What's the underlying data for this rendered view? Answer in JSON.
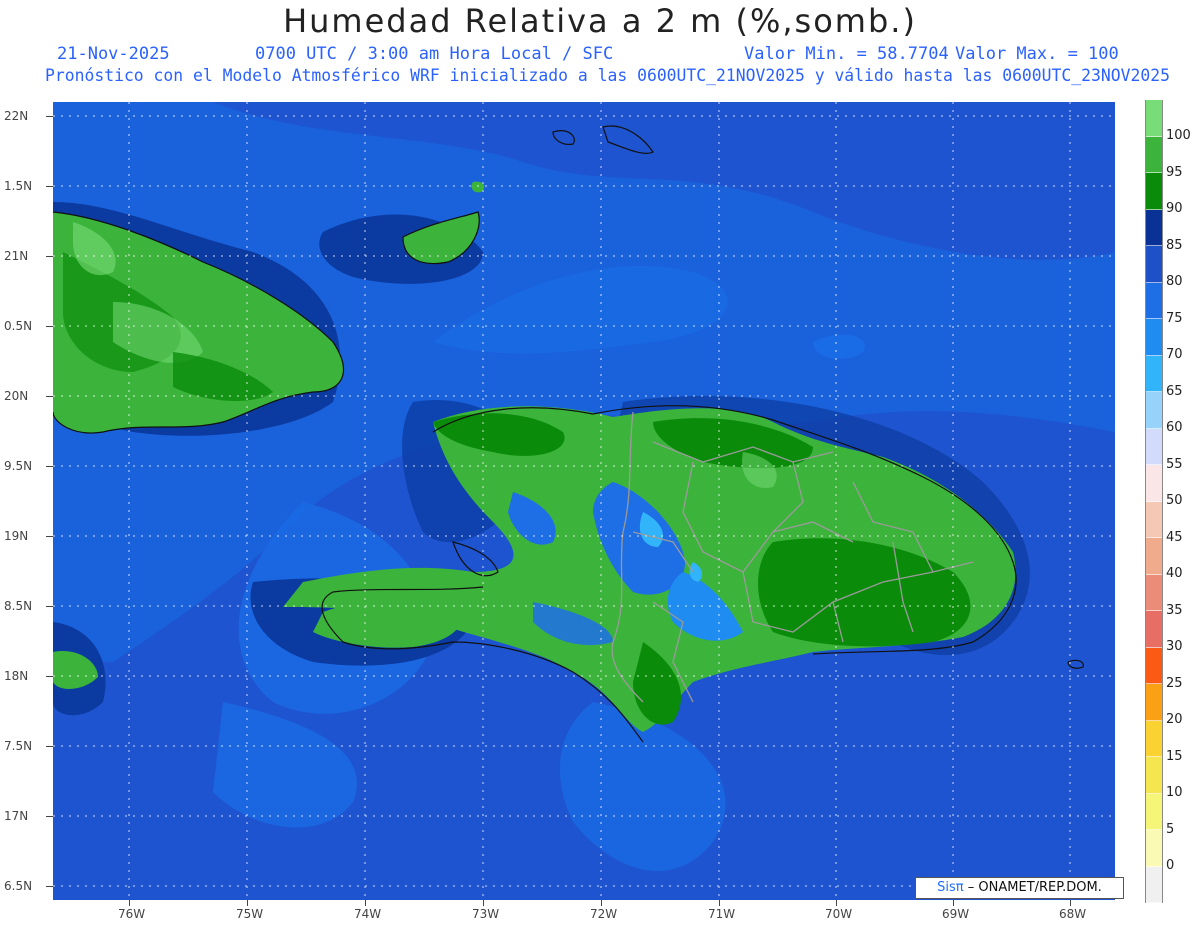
{
  "header": {
    "title": "Humedad Relativa a 2 m (%,somb.)",
    "date": "21-Nov-2025",
    "time": "0700 UTC / 3:00 am Hora Local / SFC",
    "min": "Valor Min. = 58.7704",
    "max": "Valor Max. = 100",
    "description": "Pronóstico con el Modelo Atmosférico WRF inicializado a las 0600UTC_21NOV2025 y válido hasta las  0600UTC_23NOV2025"
  },
  "lat_labels": [
    "22N",
    "1.5N",
    "21N",
    "0.5N",
    "20N",
    "9.5N",
    "19N",
    "8.5N",
    "18N",
    "7.5N",
    "17N",
    "6.5N"
  ],
  "lon_labels": [
    "76W",
    "75W",
    "74W",
    "73W",
    "72W",
    "71W",
    "70W",
    "69W",
    "68W"
  ],
  "colorbar": {
    "labels": [
      "100",
      "95",
      "90",
      "85",
      "80",
      "75",
      "70",
      "65",
      "60",
      "55",
      "50",
      "45",
      "40",
      "35",
      "30",
      "25",
      "20",
      "15",
      "10",
      "5",
      "0"
    ],
    "colors": [
      "#78dc78",
      "#3cb43c",
      "#0a8c0a",
      "#0a3296",
      "#1e50c8",
      "#1e6ee6",
      "#1e8cf0",
      "#32b4fa",
      "#96d2fa",
      "#d2dcfa",
      "#fae6e6",
      "#f5c8b4",
      "#f0aa8c",
      "#eb8c78",
      "#e66e64",
      "#fa5a14",
      "#faa014",
      "#fad232",
      "#f5e650",
      "#f5f578",
      "#fafab4",
      "#f0f0f0"
    ]
  },
  "credit": {
    "brand": "Sisπ",
    "text": "– ONAMET/REP.DOM."
  }
}
